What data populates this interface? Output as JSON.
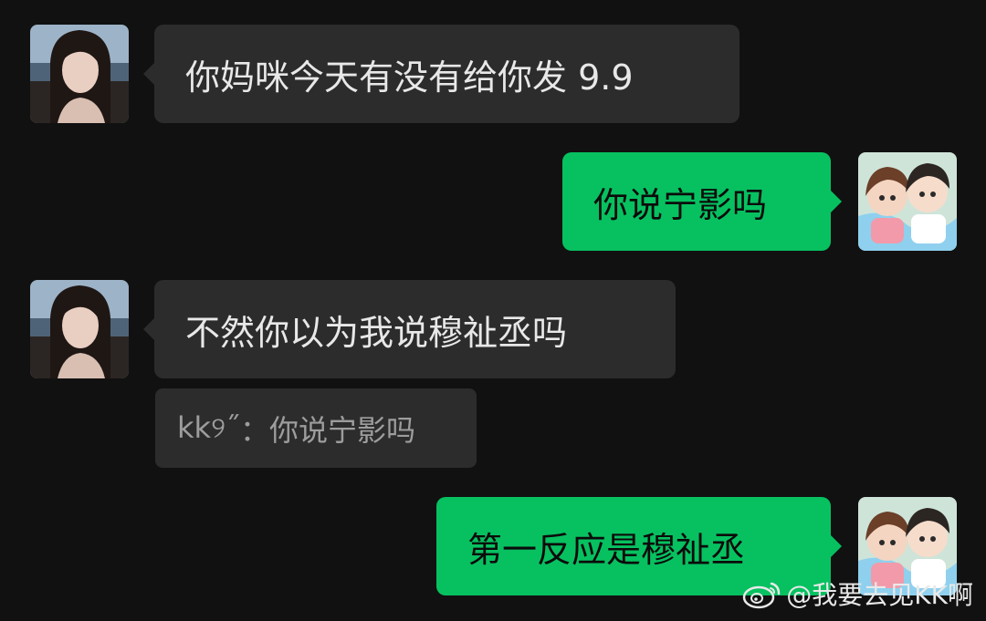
{
  "messages": [
    {
      "side": "left",
      "text": "你妈咪今天有没有给你发 9.9",
      "avatar": "girl-photo-avatar"
    },
    {
      "side": "right",
      "text": "你说宁影吗",
      "avatar": "anime-couple-avatar"
    },
    {
      "side": "left",
      "text": "不然你以为我说穆祉丞吗",
      "avatar": "girl-photo-avatar"
    },
    {
      "side": "right",
      "text": "第一反应是穆祉丞",
      "avatar": "anime-couple-avatar"
    }
  ],
  "quote": {
    "author": "kk୨˝",
    "separator": "：",
    "text": "你说宁影吗"
  },
  "watermark": {
    "text": "@我要去见KK啊",
    "icon": "weibo-logo-icon"
  },
  "colors": {
    "incoming_bubble": "#2c2c2c",
    "outgoing_bubble": "#07c160",
    "background": "#111111"
  }
}
